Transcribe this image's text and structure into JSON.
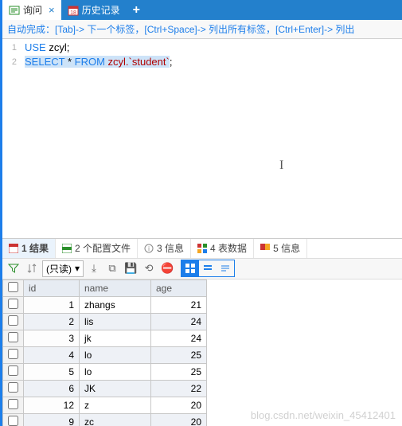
{
  "tabs": {
    "query": "询问",
    "history": "历史记录"
  },
  "hint": "自动完成：[Tab]-> 下一个标签，[Ctrl+Space]-> 列出所有标签，[Ctrl+Enter]-> 列出",
  "code": {
    "line1_num": "1",
    "line2_num": "2",
    "use_kw": "USE",
    "use_db": " zcyl;",
    "sel_kw": "SELECT",
    "star": " * ",
    "from_kw": "FROM",
    "tbl": " zcyl.`student`",
    "semi": ";"
  },
  "results_tabs": {
    "r1": "1 结果",
    "r2": "2 个配置文件",
    "r3": "3 信息",
    "r4": "4 表数据",
    "r5": "5 信息"
  },
  "toolbar": {
    "readonly": "(只读)"
  },
  "columns": {
    "id": "id",
    "name": "name",
    "age": "age"
  },
  "rows": [
    {
      "id": "1",
      "name": "zhangs",
      "age": "21"
    },
    {
      "id": "2",
      "name": "lis",
      "age": "24"
    },
    {
      "id": "3",
      "name": "jk",
      "age": "24"
    },
    {
      "id": "4",
      "name": "lo",
      "age": "25"
    },
    {
      "id": "5",
      "name": "lo",
      "age": "25"
    },
    {
      "id": "6",
      "name": "JK",
      "age": "22"
    },
    {
      "id": "12",
      "name": "z",
      "age": "20"
    },
    {
      "id": "9",
      "name": "zc",
      "age": "20"
    }
  ],
  "watermark": "blog.csdn.net/weixin_45412401"
}
